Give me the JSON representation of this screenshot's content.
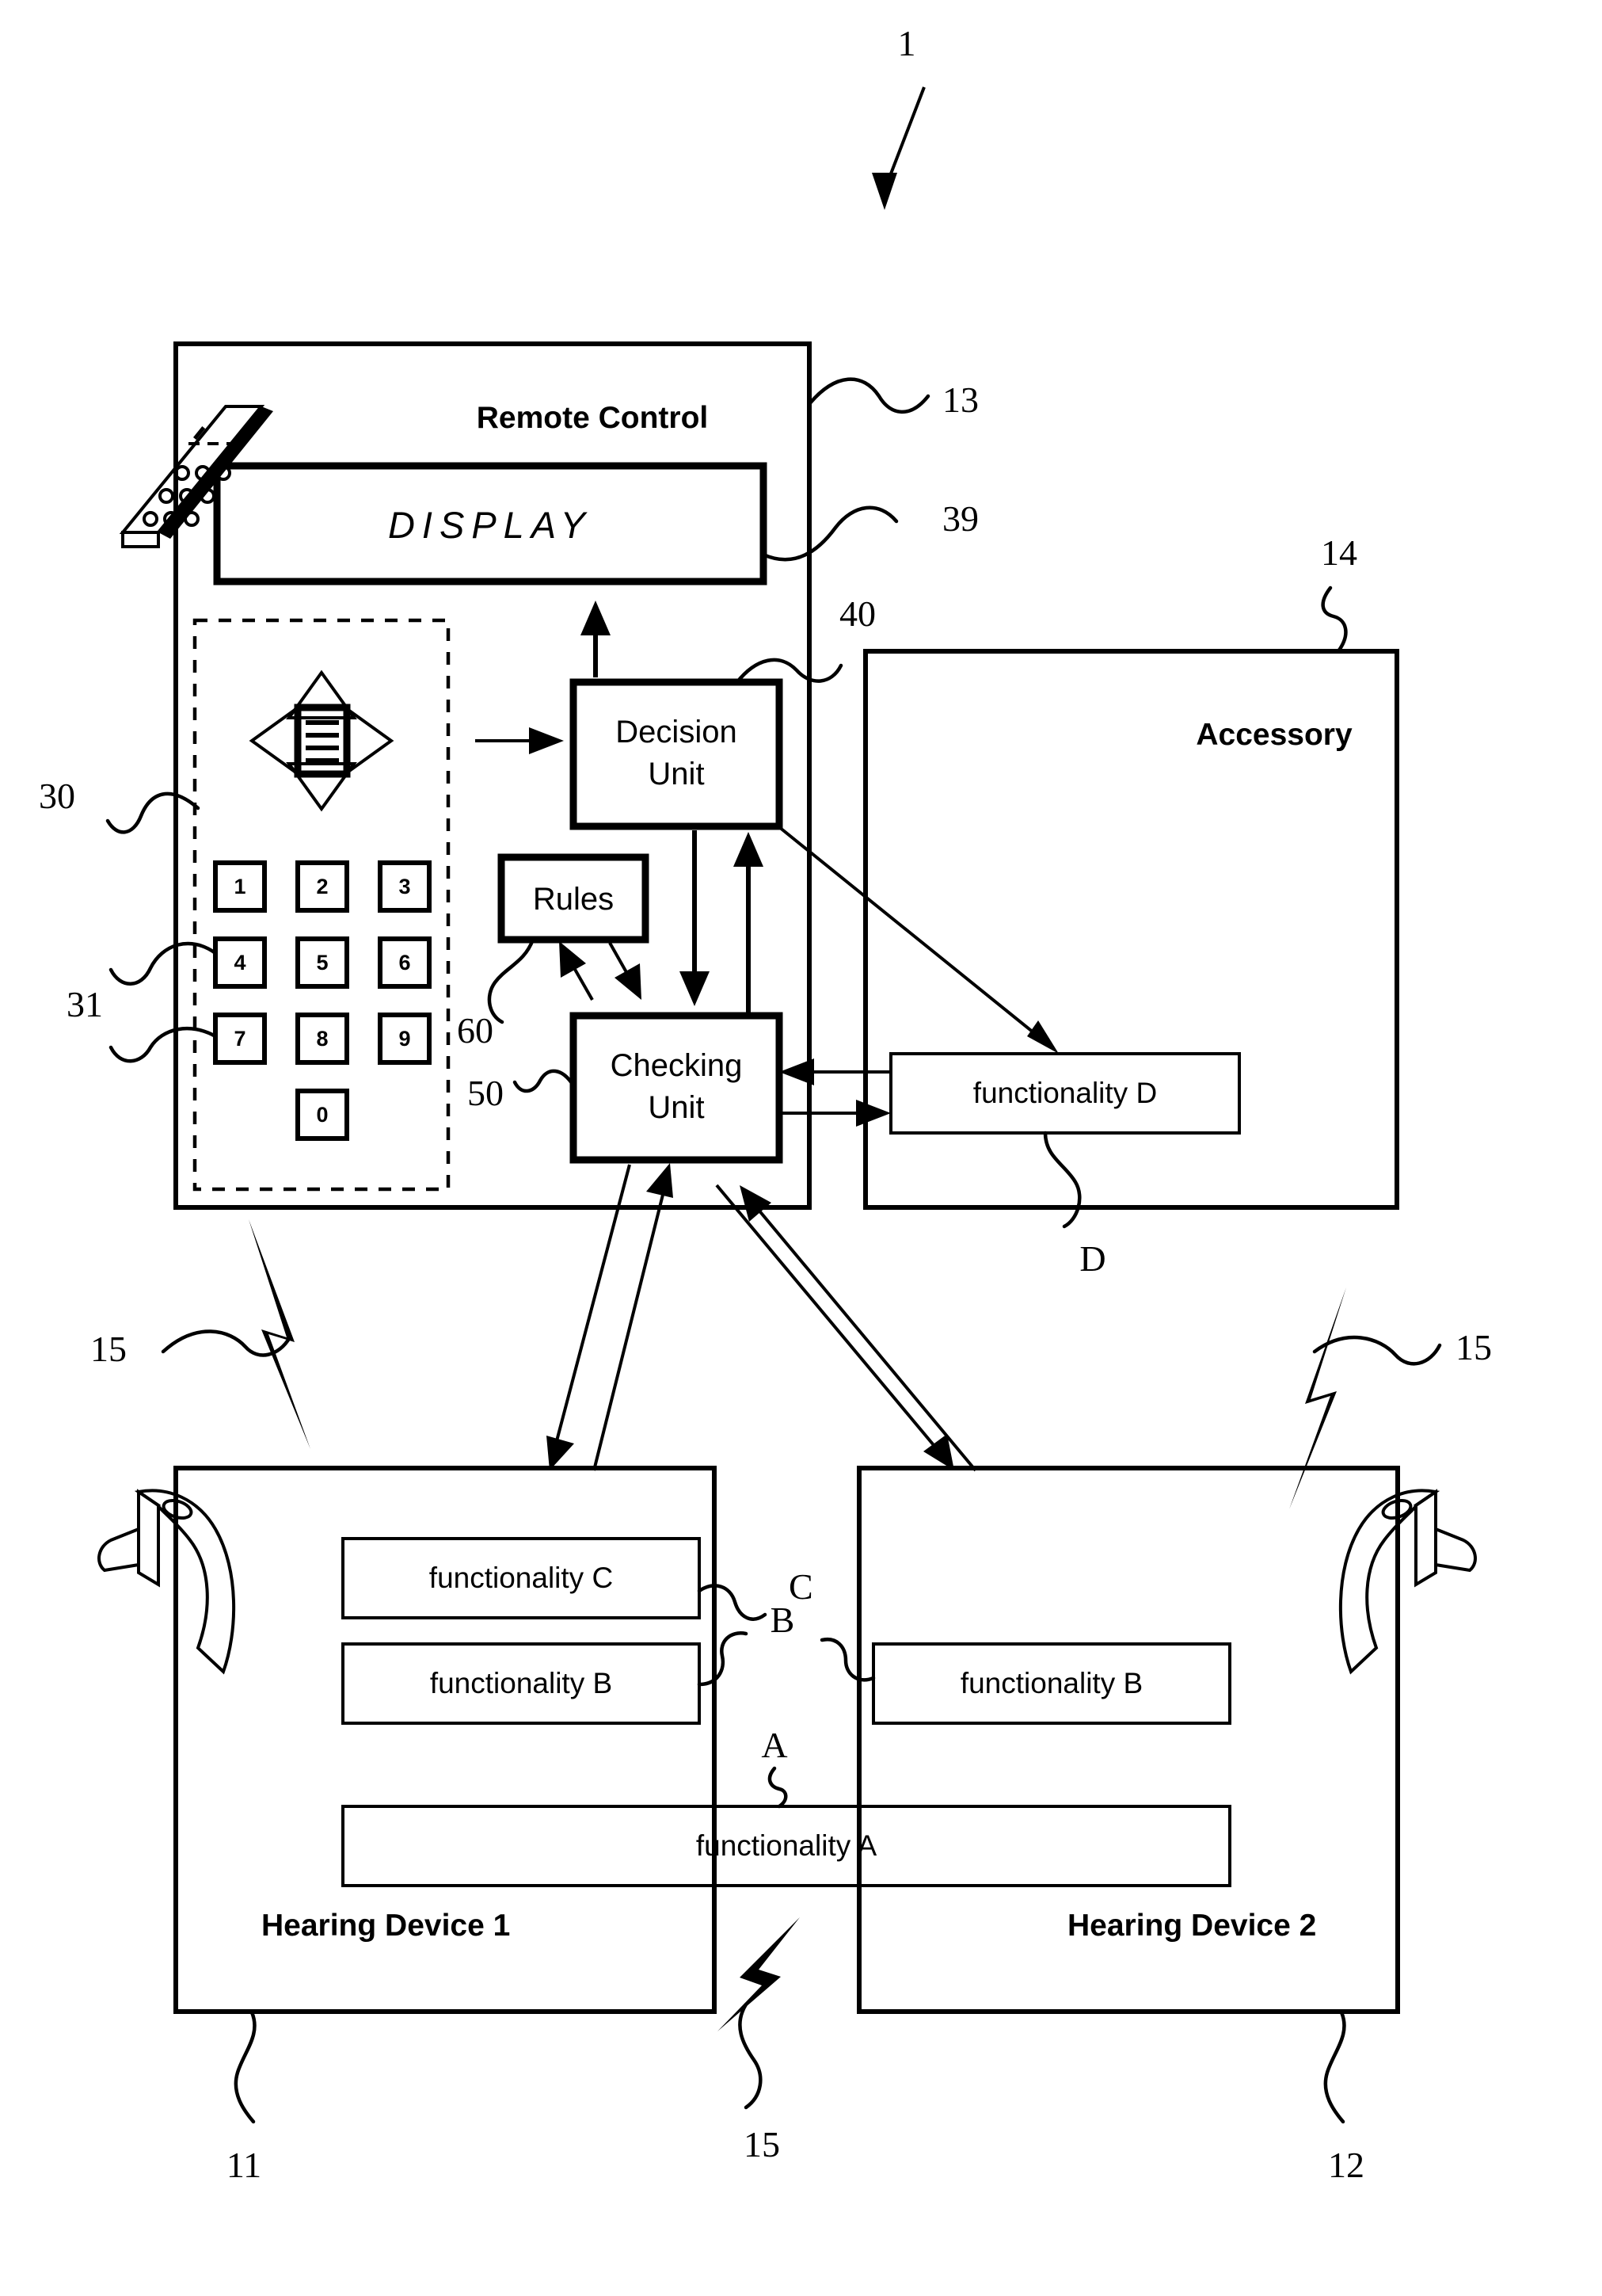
{
  "figure": {
    "id": "1",
    "domain": "patent-block-diagram",
    "title_text": "1"
  },
  "blocks": {
    "remote_control": {
      "label": "Remote Control",
      "ref": "13",
      "display": {
        "label": "DISPLAY",
        "ref": "39"
      },
      "decision_unit": {
        "label_line1": "Decision",
        "label_line2": "Unit",
        "ref": "40"
      },
      "rules": {
        "label": "Rules",
        "ref": "60"
      },
      "checking_unit": {
        "label_line1": "Checking",
        "label_line2": "Unit",
        "ref": "50"
      }
    },
    "accessory": {
      "label": "Accessory",
      "ref": "14",
      "functionality": {
        "label": "functionality D",
        "ref": "D"
      }
    },
    "hearing_device_1": {
      "label": "Hearing Device 1",
      "ref": "11",
      "functionalities": [
        {
          "label": "functionality C",
          "ref": "C"
        },
        {
          "label": "functionality B",
          "ref": "B"
        }
      ]
    },
    "hearing_device_2": {
      "label": "Hearing Device 2",
      "ref": "12",
      "functionalities": [
        {
          "label": "functionality B",
          "ref": "B"
        }
      ]
    },
    "shared_functionality": {
      "label": "functionality A",
      "ref": "A"
    }
  },
  "input_panel": {
    "ref_panel": "30",
    "ref_keypad": "31",
    "navpad": {
      "up": "nav-up-arrow",
      "down": "nav-down-arrow",
      "left": "nav-left-arrow",
      "right": "nav-right-arrow",
      "center": "menu-list-icon"
    },
    "keys": [
      "1",
      "2",
      "3",
      "4",
      "5",
      "6",
      "7",
      "8",
      "9",
      "0"
    ]
  },
  "wireless_links": [
    {
      "ref": "15",
      "position": "left"
    },
    {
      "ref": "15",
      "position": "right"
    },
    {
      "ref": "15",
      "position": "bottom-center"
    }
  ],
  "icons": {
    "remote_control_device": "handheld-remote-icon",
    "hearing_aid_left": "bte-hearing-aid-icon",
    "hearing_aid_right": "bte-hearing-aid-icon",
    "lightning": "lightning-bolt-icon",
    "figure_pointer": "figure-pointer-arrow"
  },
  "colors": {
    "ink": "#000000",
    "paper": "#ffffff"
  }
}
